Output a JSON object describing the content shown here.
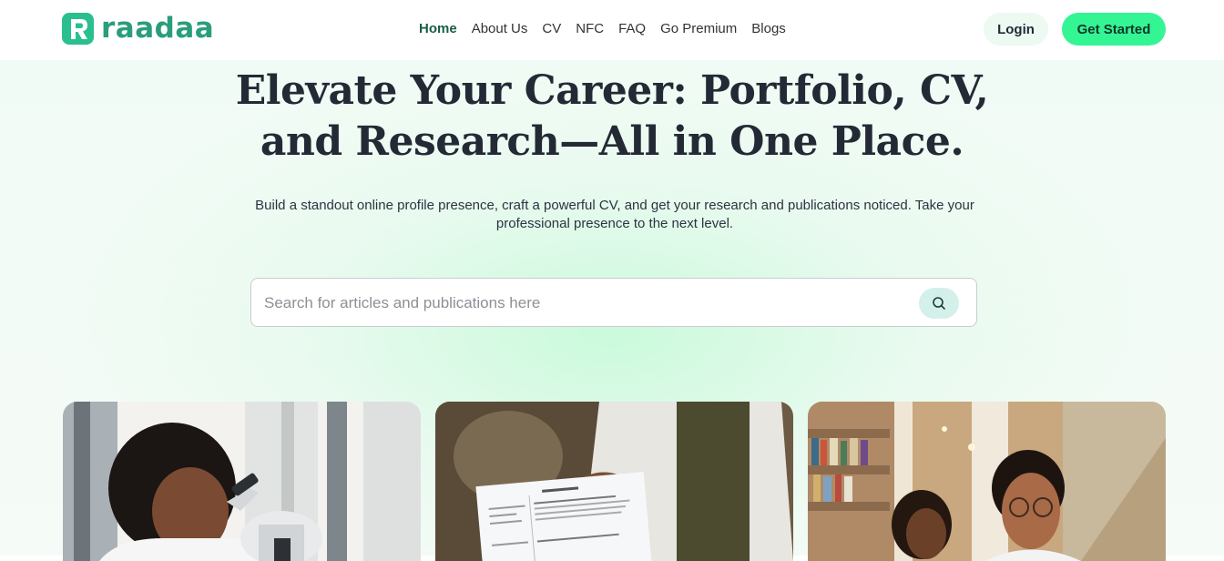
{
  "brand": {
    "name": "raadaa",
    "color": "#2a9d7c"
  },
  "nav": {
    "items": [
      {
        "label": "Home",
        "active": true
      },
      {
        "label": "About Us",
        "active": false
      },
      {
        "label": "CV",
        "active": false
      },
      {
        "label": "NFC",
        "active": false
      },
      {
        "label": "FAQ",
        "active": false
      },
      {
        "label": "Go Premium",
        "active": false
      },
      {
        "label": "Blogs",
        "active": false
      }
    ],
    "login_label": "Login",
    "get_started_label": "Get Started"
  },
  "hero": {
    "title_line1": "Elevate Your Career: Portfolio, CV,",
    "title_line2": "and Research—All in One Place.",
    "subtitle_line1": "Build a standout online profile presence, craft a powerful CV, and get your research and publications noticed. Take your",
    "subtitle_line2": "professional presence to the next level."
  },
  "search": {
    "placeholder": "Search for articles and publications here",
    "value": "",
    "icon": "search-icon"
  },
  "cards": [
    {
      "image": "scientist-microscope-photo"
    },
    {
      "image": "resume-handover-photo"
    },
    {
      "image": "library-students-photo"
    }
  ],
  "colors": {
    "accent": "#34f594",
    "login_bg": "#ecfaf2",
    "nav_active": "#1a5d45",
    "search_button_bg": "#d4f0ea"
  }
}
